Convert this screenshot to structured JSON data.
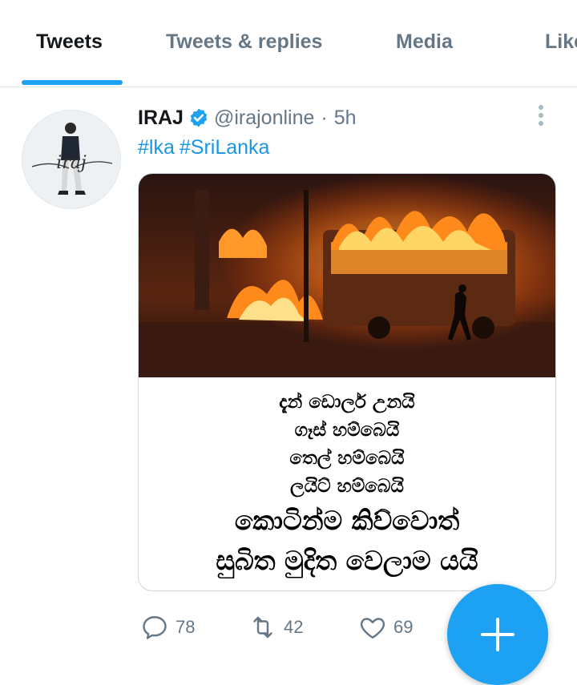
{
  "tabs": [
    {
      "label": "Tweets",
      "active": true
    },
    {
      "label": "Tweets & replies",
      "active": false
    },
    {
      "label": "Media",
      "active": false
    },
    {
      "label": "Likes",
      "active": false
    }
  ],
  "tweet": {
    "display_name": "IRAJ",
    "verified": true,
    "handle": "@irajonline",
    "separator": "·",
    "time": "5h",
    "hashtags": [
      "#lka",
      "#SriLanka"
    ],
    "avatar_text": "iraj",
    "image_caption_lines": [
      "දැන් ඩොලර් උනයි",
      "ගෑස් හම්බෙයි",
      "තෙල් හම්බෙයි",
      "ලයිට් හම්බෙයි",
      "කොටින්ම කිව්වොත්",
      "සුබිත මුදිත වෙලාම යයි"
    ],
    "replies": "78",
    "retweets": "42",
    "likes": "69"
  },
  "colors": {
    "accent": "#1da1f2",
    "link": "#1b95e0",
    "secondary_text": "#657786",
    "divider": "#e1e8ed"
  },
  "icons": [
    "verified-badge-icon",
    "more-options-icon",
    "reply-icon",
    "retweet-icon",
    "like-icon",
    "compose-plus-icon"
  ]
}
